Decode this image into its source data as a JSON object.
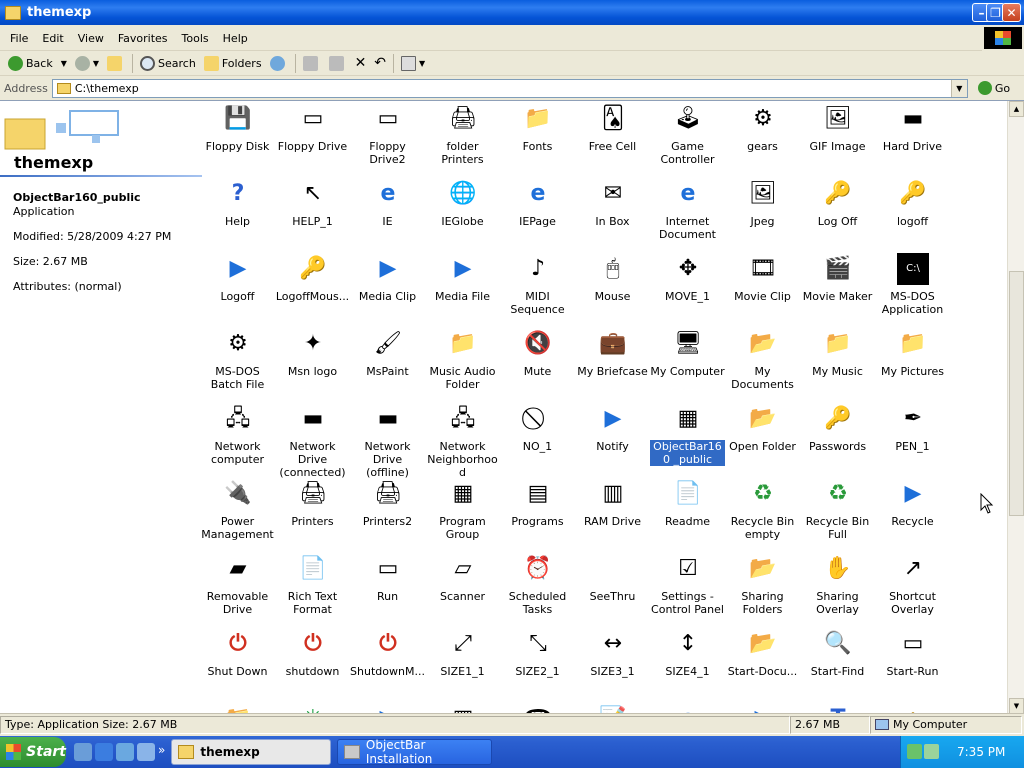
{
  "window": {
    "title": "themexp"
  },
  "menu": [
    "File",
    "Edit",
    "View",
    "Favorites",
    "Tools",
    "Help"
  ],
  "toolbar": {
    "back": "Back",
    "search": "Search",
    "folders": "Folders"
  },
  "address": {
    "label": "Address",
    "value": "C:\\themexp",
    "go": "Go"
  },
  "details": {
    "folder_title": "themexp",
    "file_name": "ObjectBar160_public",
    "file_type": "Application",
    "modified": "Modified: 5/28/2009 4:27 PM",
    "size": "Size: 2.67 MB",
    "attributes": "Attributes: (normal)"
  },
  "icons": [
    {
      "label": "Floppy Disk",
      "icon": "floppy-disk-icon"
    },
    {
      "label": "Floppy Drive",
      "icon": "floppy-drive-icon"
    },
    {
      "label": "Floppy Drive2",
      "icon": "floppy-drive-icon"
    },
    {
      "label": "folder Printers",
      "icon": "printer-folder-icon"
    },
    {
      "label": "Fonts",
      "icon": "folder-icon"
    },
    {
      "label": "Free Cell",
      "icon": "cards-icon"
    },
    {
      "label": "Game Controller",
      "icon": "joystick-icon"
    },
    {
      "label": "gears",
      "icon": "gears-icon"
    },
    {
      "label": "GIF Image",
      "icon": "image-icon"
    },
    {
      "label": "Hard Drive",
      "icon": "hard-drive-icon"
    },
    {
      "label": "Help",
      "icon": "help-icon"
    },
    {
      "label": "HELP_1",
      "icon": "help-cursor-icon"
    },
    {
      "label": "IE",
      "icon": "ie-icon"
    },
    {
      "label": "IEGlobe",
      "icon": "globe-icon"
    },
    {
      "label": "IEPage",
      "icon": "ie-page-icon"
    },
    {
      "label": "In Box",
      "icon": "inbox-icon"
    },
    {
      "label": "Internet Document",
      "icon": "ie-page-icon"
    },
    {
      "label": "Jpeg",
      "icon": "image-icon"
    },
    {
      "label": "Log Off",
      "icon": "key-icon"
    },
    {
      "label": "logoff",
      "icon": "key-icon"
    },
    {
      "label": "Logoff",
      "icon": "media-icon"
    },
    {
      "label": "LogoffMous...",
      "icon": "key-icon"
    },
    {
      "label": "Media Clip",
      "icon": "media-icon"
    },
    {
      "label": "Media File",
      "icon": "media-icon"
    },
    {
      "label": "MIDI Sequence",
      "icon": "music-note-icon"
    },
    {
      "label": "Mouse",
      "icon": "mouse-icon"
    },
    {
      "label": "MOVE_1",
      "icon": "move-cursor-icon"
    },
    {
      "label": "Movie Clip",
      "icon": "movie-icon"
    },
    {
      "label": "Movie Maker",
      "icon": "film-icon"
    },
    {
      "label": "MS-DOS Application",
      "icon": "dos-icon"
    },
    {
      "label": "MS-DOS Batch File",
      "icon": "batch-file-icon"
    },
    {
      "label": "Msn logo",
      "icon": "butterfly-icon"
    },
    {
      "label": "MsPaint",
      "icon": "paint-icon"
    },
    {
      "label": "Music Audio Folder",
      "icon": "music-folder-icon"
    },
    {
      "label": "Mute",
      "icon": "mute-icon"
    },
    {
      "label": "My Briefcase",
      "icon": "briefcase-icon"
    },
    {
      "label": "My Computer",
      "icon": "computer-icon"
    },
    {
      "label": "My Documents",
      "icon": "documents-folder-icon"
    },
    {
      "label": "My Music",
      "icon": "music-folder-icon"
    },
    {
      "label": "My Pictures",
      "icon": "pictures-folder-icon"
    },
    {
      "label": "Network computer",
      "icon": "network-computer-icon"
    },
    {
      "label": "Network Drive (connected)",
      "icon": "network-drive-icon"
    },
    {
      "label": "Network Drive (offline)",
      "icon": "network-drive-offline-icon"
    },
    {
      "label": "Network Neighborhood",
      "icon": "network-neighborhood-icon"
    },
    {
      "label": "NO_1",
      "icon": "no-cursor-icon"
    },
    {
      "label": "Notify",
      "icon": "media-icon"
    },
    {
      "label": "ObjectBar160 _public",
      "icon": "objectbar-icon",
      "selected": true
    },
    {
      "label": "Open Folder",
      "icon": "open-folder-icon"
    },
    {
      "label": "Passwords",
      "icon": "keys-icon"
    },
    {
      "label": "PEN_1",
      "icon": "pen-cursor-icon"
    },
    {
      "label": "Power Management",
      "icon": "power-icon"
    },
    {
      "label": "Printers",
      "icon": "printer-icon"
    },
    {
      "label": "Printers2",
      "icon": "printer-icon"
    },
    {
      "label": "Program Group",
      "icon": "program-group-icon"
    },
    {
      "label": "Programs",
      "icon": "programs-icon"
    },
    {
      "label": "RAM Drive",
      "icon": "ram-chip-icon"
    },
    {
      "label": "Readme",
      "icon": "document-icon"
    },
    {
      "label": "Recycle Bin empty",
      "icon": "recycle-bin-empty-icon"
    },
    {
      "label": "Recycle Bin Full",
      "icon": "recycle-bin-full-icon"
    },
    {
      "label": "Recycle",
      "icon": "media-icon"
    },
    {
      "label": "Removable Drive",
      "icon": "removable-drive-icon"
    },
    {
      "label": "Rich Text Format",
      "icon": "rtf-document-icon"
    },
    {
      "label": "Run",
      "icon": "run-icon"
    },
    {
      "label": "Scanner",
      "icon": "scanner-icon"
    },
    {
      "label": "Scheduled Tasks",
      "icon": "scheduled-tasks-icon"
    },
    {
      "label": "SeeThru",
      "icon": "blank-icon"
    },
    {
      "label": "Settings - Control Panel",
      "icon": "control-panel-icon"
    },
    {
      "label": "Sharing Folders",
      "icon": "sharing-folder-icon"
    },
    {
      "label": "Sharing Overlay",
      "icon": "sharing-hand-icon"
    },
    {
      "label": "Shortcut Overlay",
      "icon": "shortcut-arrow-icon"
    },
    {
      "label": "Shut Down",
      "icon": "shutdown-icon"
    },
    {
      "label": "shutdown",
      "icon": "shutdown-icon"
    },
    {
      "label": "ShutdownM...",
      "icon": "shutdown-icon"
    },
    {
      "label": "SIZE1_1",
      "icon": "resize-diag-icon"
    },
    {
      "label": "SIZE2_1",
      "icon": "resize-diag2-icon"
    },
    {
      "label": "SIZE3_1",
      "icon": "resize-horizontal-icon"
    },
    {
      "label": "SIZE4_1",
      "icon": "resize-vertical-icon"
    },
    {
      "label": "Start-Docu...",
      "icon": "documents-folder-icon"
    },
    {
      "label": "Start-Find",
      "icon": "magnifier-icon"
    },
    {
      "label": "Start-Run",
      "icon": "run-icon"
    },
    {
      "label": "",
      "icon": "folder-icon"
    },
    {
      "label": "",
      "icon": "asterisk-icon"
    },
    {
      "label": "",
      "icon": "media-icon"
    },
    {
      "label": "",
      "icon": "system-icon"
    },
    {
      "label": "",
      "icon": "phone-icon"
    },
    {
      "label": "",
      "icon": "notepad-icon"
    },
    {
      "label": "",
      "icon": "ie-icon"
    },
    {
      "label": "",
      "icon": "media-icon"
    },
    {
      "label": "",
      "icon": "font-icon"
    },
    {
      "label": "",
      "icon": "eject-icon"
    }
  ],
  "status": {
    "left": "Type: Application Size: 2.67 MB",
    "size": "2.67 MB",
    "zone": "My Computer"
  },
  "taskbar": {
    "start": "Start",
    "task1": "themexp",
    "task2": "ObjectBar Installation",
    "clock": "7:35 PM"
  }
}
